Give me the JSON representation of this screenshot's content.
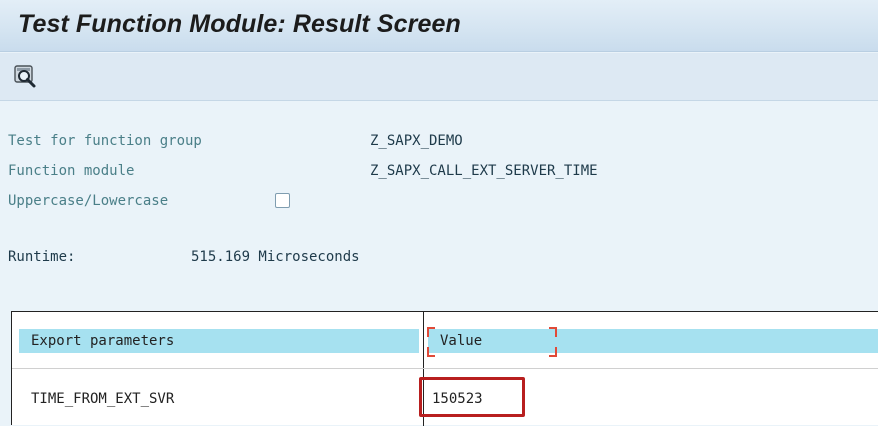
{
  "title": "Test Function Module: Result Screen",
  "toolbar": {
    "icon": "inspect-magnifier-icon"
  },
  "info": {
    "function_group_label": "Test for function group",
    "function_group_value": "Z_SAPX_DEMO",
    "function_module_label": "Function module",
    "function_module_value": "Z_SAPX_CALL_EXT_SERVER_TIME",
    "case_label": "Uppercase/Lowercase",
    "case_checked": false,
    "runtime_label": "Runtime:",
    "runtime_value": "515.169 Microseconds"
  },
  "table": {
    "col1_header": "Export parameters",
    "col2_header": "Value",
    "rows": [
      {
        "param": "TIME_FROM_EXT_SVR",
        "value": "150523"
      }
    ]
  },
  "colors": {
    "highlight": "#b81f1f",
    "header_cell": "#a6e1f0",
    "label_text": "#4a7f88"
  }
}
